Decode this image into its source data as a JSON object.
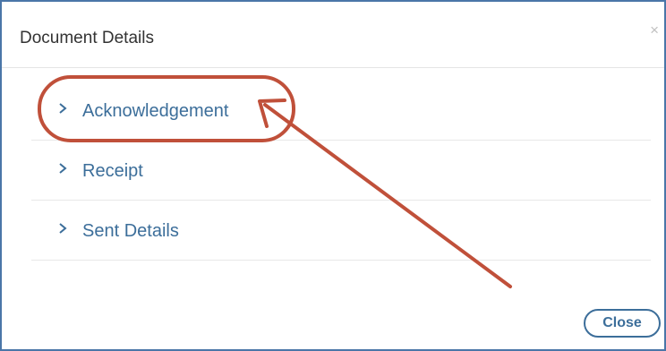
{
  "dialog": {
    "title": "Document Details",
    "close_icon": "×"
  },
  "items": [
    {
      "label": "Acknowledgement",
      "icon": "chevron-right-icon"
    },
    {
      "label": "Receipt",
      "icon": "chevron-right-icon"
    },
    {
      "label": "Sent Details",
      "icon": "chevron-right-icon"
    }
  ],
  "footer": {
    "close_label": "Close"
  },
  "annotation": {
    "highlight_target": "Acknowledgement",
    "color": "#c0503a"
  },
  "colors": {
    "border": "#4a76a8",
    "link": "#3c6e9a",
    "annotation": "#c0503a"
  }
}
